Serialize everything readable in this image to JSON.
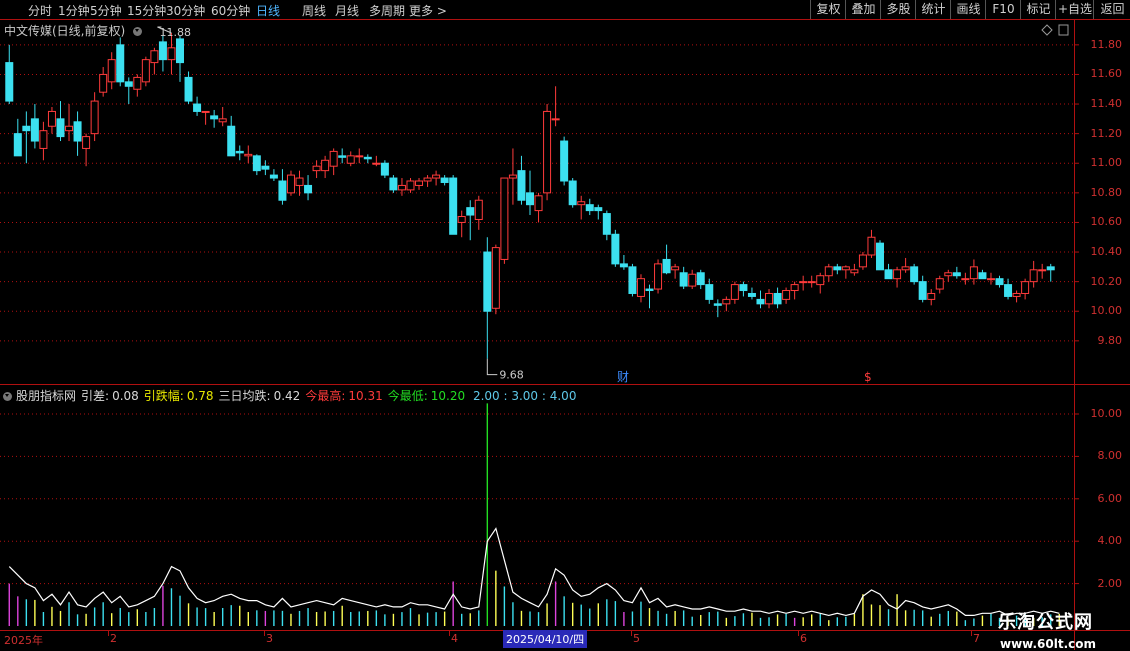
{
  "toolbar": {
    "periods": [
      "分时",
      "1分钟",
      "5分钟",
      "15分钟",
      "30分钟",
      "60分钟",
      "日线",
      "周线",
      "月线",
      "多周期",
      "更多 >"
    ],
    "active_period": "日线",
    "tools": [
      "复权",
      "叠加",
      "多股",
      "统计",
      "画线",
      "F10",
      "标记",
      "+自选",
      "返回"
    ]
  },
  "main_chart": {
    "title": "中文传媒(日线,前复权)",
    "high_label": "11.88",
    "low_label": "9.68",
    "markers": [
      "财",
      "$"
    ],
    "y_ticks": [
      "11.80",
      "11.60",
      "11.40",
      "11.20",
      "11.00",
      "10.80",
      "10.60",
      "10.40",
      "10.20",
      "10.00",
      "9.80"
    ]
  },
  "indicator": {
    "name": "股朋指标网",
    "items": [
      {
        "label": "引差:",
        "value": "0.08",
        "color": "#d8d8d8"
      },
      {
        "label": "引跌幅:",
        "value": "0.78",
        "color": "#e8e800"
      },
      {
        "label": "三日均跌:",
        "value": "0.42",
        "color": "#d8d8d8"
      },
      {
        "label": "今最高:",
        "value": "10.31",
        "color": "#ff3b3b"
      },
      {
        "label": "今最低:",
        "value": "10.20",
        "color": "#22dd22"
      }
    ],
    "extra_levels": "2.00 : 3.00 : 4.00",
    "y_ticks": [
      "10.00",
      "8.00",
      "6.00",
      "4.00",
      "2.00"
    ]
  },
  "x_axis": {
    "labels": [
      "2025年",
      "2",
      "3",
      "4",
      "5",
      "6",
      "7"
    ],
    "cursor_date": "2025/04/10/四"
  },
  "colors": {
    "up": "#ff3b3b",
    "down": "#3ce0f0",
    "grid": "#b01010",
    "line": "#ffffff"
  },
  "watermark": {
    "title": "乐淘公式网",
    "url": "www.60lt.com"
  },
  "chart_data": {
    "type": "candlestick",
    "candles": [
      [
        11.68,
        11.8,
        11.4,
        11.42
      ],
      [
        11.2,
        11.3,
        11.1,
        11.05
      ],
      [
        11.25,
        11.35,
        11.0,
        11.22
      ],
      [
        11.3,
        11.4,
        11.1,
        11.15
      ],
      [
        11.1,
        11.28,
        11.02,
        11.22
      ],
      [
        11.25,
        11.38,
        11.2,
        11.35
      ],
      [
        11.3,
        11.42,
        11.15,
        11.18
      ],
      [
        11.22,
        11.4,
        11.15,
        11.25
      ],
      [
        11.28,
        11.35,
        11.05,
        11.15
      ],
      [
        11.1,
        11.2,
        10.98,
        11.18
      ],
      [
        11.2,
        11.48,
        11.15,
        11.42
      ],
      [
        11.48,
        11.65,
        11.45,
        11.6
      ],
      [
        11.55,
        11.75,
        11.5,
        11.7
      ],
      [
        11.8,
        11.85,
        11.52,
        11.55
      ],
      [
        11.55,
        11.58,
        11.4,
        11.52
      ],
      [
        11.5,
        11.6,
        11.45,
        11.58
      ],
      [
        11.55,
        11.72,
        11.52,
        11.7
      ],
      [
        11.68,
        11.78,
        11.6,
        11.76
      ],
      [
        11.82,
        11.86,
        11.62,
        11.7
      ],
      [
        11.7,
        11.88,
        11.6,
        11.78
      ],
      [
        11.84,
        11.86,
        11.55,
        11.68
      ],
      [
        11.58,
        11.62,
        11.4,
        11.42
      ],
      [
        11.4,
        11.45,
        11.32,
        11.35
      ],
      [
        11.35,
        11.35,
        11.26,
        11.35
      ],
      [
        11.32,
        11.36,
        11.24,
        11.3
      ],
      [
        11.28,
        11.38,
        11.25,
        11.3
      ],
      [
        11.25,
        11.32,
        11.05,
        11.05
      ],
      [
        11.08,
        11.12,
        11.02,
        11.07
      ],
      [
        11.05,
        11.12,
        11.0,
        11.06
      ],
      [
        11.05,
        11.06,
        10.92,
        10.95
      ],
      [
        10.98,
        11.02,
        10.92,
        10.96
      ],
      [
        10.92,
        10.96,
        10.88,
        10.9
      ],
      [
        10.88,
        10.96,
        10.72,
        10.75
      ],
      [
        10.8,
        10.95,
        10.78,
        10.92
      ],
      [
        10.85,
        10.95,
        10.78,
        10.9
      ],
      [
        10.85,
        10.92,
        10.75,
        10.8
      ],
      [
        10.95,
        11.02,
        10.9,
        10.98
      ],
      [
        10.95,
        11.05,
        10.9,
        11.02
      ],
      [
        10.98,
        11.1,
        10.92,
        11.08
      ],
      [
        11.05,
        11.1,
        11.0,
        11.04
      ],
      [
        11.0,
        11.08,
        10.98,
        11.05
      ],
      [
        11.05,
        11.1,
        11.0,
        11.05
      ],
      [
        11.04,
        11.06,
        11.0,
        11.03
      ],
      [
        11.0,
        11.05,
        10.98,
        11.0
      ],
      [
        11.0,
        11.02,
        10.9,
        10.92
      ],
      [
        10.9,
        10.92,
        10.8,
        10.82
      ],
      [
        10.82,
        10.9,
        10.78,
        10.85
      ],
      [
        10.82,
        10.9,
        10.8,
        10.88
      ],
      [
        10.85,
        10.9,
        10.82,
        10.88
      ],
      [
        10.88,
        10.92,
        10.84,
        10.9
      ],
      [
        10.9,
        10.95,
        10.85,
        10.92
      ],
      [
        10.9,
        10.92,
        10.85,
        10.87
      ],
      [
        10.9,
        10.92,
        10.52,
        10.52
      ],
      [
        10.6,
        10.68,
        10.5,
        10.64
      ],
      [
        10.7,
        10.75,
        10.48,
        10.65
      ],
      [
        10.62,
        10.78,
        10.55,
        10.75
      ],
      [
        10.4,
        10.5,
        9.68,
        10.0
      ],
      [
        10.02,
        10.45,
        9.98,
        10.43
      ],
      [
        10.35,
        10.9,
        10.32,
        10.9
      ],
      [
        10.9,
        11.1,
        10.72,
        10.92
      ],
      [
        10.95,
        11.05,
        10.72,
        10.75
      ],
      [
        10.8,
        10.95,
        10.65,
        10.72
      ],
      [
        10.68,
        10.8,
        10.6,
        10.78
      ],
      [
        10.8,
        11.4,
        10.75,
        11.35
      ],
      [
        11.3,
        11.52,
        11.25,
        11.3
      ],
      [
        11.15,
        11.18,
        10.85,
        10.88
      ],
      [
        10.88,
        10.9,
        10.7,
        10.72
      ],
      [
        10.72,
        10.78,
        10.62,
        10.74
      ],
      [
        10.72,
        10.76,
        10.65,
        10.68
      ],
      [
        10.7,
        10.72,
        10.62,
        10.68
      ],
      [
        10.66,
        10.68,
        10.48,
        10.52
      ],
      [
        10.52,
        10.55,
        10.3,
        10.32
      ],
      [
        10.32,
        10.38,
        10.28,
        10.3
      ],
      [
        10.3,
        10.32,
        10.1,
        10.12
      ],
      [
        10.1,
        10.25,
        10.06,
        10.22
      ],
      [
        10.15,
        10.18,
        10.02,
        10.14
      ],
      [
        10.15,
        10.35,
        10.12,
        10.32
      ],
      [
        10.35,
        10.45,
        10.25,
        10.26
      ],
      [
        10.28,
        10.32,
        10.22,
        10.3
      ],
      [
        10.26,
        10.3,
        10.15,
        10.17
      ],
      [
        10.17,
        10.28,
        10.15,
        10.25
      ],
      [
        10.26,
        10.28,
        10.15,
        10.18
      ],
      [
        10.18,
        10.22,
        10.05,
        10.08
      ],
      [
        10.05,
        10.08,
        9.96,
        10.04
      ],
      [
        10.05,
        10.1,
        10.0,
        10.08
      ],
      [
        10.08,
        10.2,
        10.05,
        10.18
      ],
      [
        10.18,
        10.2,
        10.1,
        10.14
      ],
      [
        10.12,
        10.16,
        10.08,
        10.1
      ],
      [
        10.08,
        10.14,
        10.02,
        10.05
      ],
      [
        10.05,
        10.15,
        10.02,
        10.12
      ],
      [
        10.12,
        10.16,
        10.02,
        10.05
      ],
      [
        10.08,
        10.16,
        10.05,
        10.14
      ],
      [
        10.14,
        10.2,
        10.08,
        10.18
      ],
      [
        10.2,
        10.24,
        10.14,
        10.2
      ],
      [
        10.2,
        10.24,
        10.16,
        10.2
      ],
      [
        10.18,
        10.26,
        10.12,
        10.24
      ],
      [
        10.24,
        10.32,
        10.2,
        10.3
      ],
      [
        10.3,
        10.32,
        10.25,
        10.28
      ],
      [
        10.28,
        10.31,
        10.22,
        10.3
      ],
      [
        10.26,
        10.32,
        10.24,
        10.28
      ],
      [
        10.3,
        10.4,
        10.28,
        10.38
      ],
      [
        10.38,
        10.55,
        10.36,
        10.5
      ],
      [
        10.46,
        10.48,
        10.28,
        10.28
      ],
      [
        10.28,
        10.32,
        10.22,
        10.22
      ],
      [
        10.22,
        10.3,
        10.16,
        10.28
      ],
      [
        10.28,
        10.36,
        10.26,
        10.3
      ],
      [
        10.3,
        10.32,
        10.18,
        10.2
      ],
      [
        10.2,
        10.24,
        10.06,
        10.08
      ],
      [
        10.08,
        10.15,
        10.04,
        10.12
      ],
      [
        10.15,
        10.24,
        10.12,
        10.22
      ],
      [
        10.24,
        10.28,
        10.2,
        10.26
      ],
      [
        10.26,
        10.3,
        10.22,
        10.24
      ],
      [
        10.22,
        10.26,
        10.18,
        10.22
      ],
      [
        10.22,
        10.35,
        10.18,
        10.3
      ],
      [
        10.26,
        10.28,
        10.22,
        10.22
      ],
      [
        10.22,
        10.26,
        10.18,
        10.22
      ],
      [
        10.22,
        10.24,
        10.16,
        10.18
      ],
      [
        10.18,
        10.22,
        10.08,
        10.1
      ],
      [
        10.1,
        10.14,
        10.06,
        10.12
      ],
      [
        10.12,
        10.22,
        10.08,
        10.2
      ],
      [
        10.2,
        10.34,
        10.16,
        10.28
      ],
      [
        10.28,
        10.32,
        10.22,
        10.28
      ],
      [
        10.3,
        10.32,
        10.2,
        10.28
      ]
    ],
    "indicator_values": [
      2.8,
      2.4,
      2.0,
      1.8,
      1.2,
      1.5,
      1.0,
      1.6,
      1.0,
      0.9,
      1.3,
      1.6,
      1.1,
      1.4,
      0.9,
      1.0,
      1.2,
      1.4,
      2.0,
      2.8,
      2.6,
      1.8,
      1.3,
      1.1,
      1.2,
      1.4,
      1.5,
      1.3,
      1.2,
      1.2,
      1.0,
      0.9,
      1.3,
      0.9,
      1.0,
      1.1,
      1.2,
      1.1,
      1.0,
      1.3,
      1.2,
      1.1,
      1.0,
      0.9,
      1.0,
      0.9,
      0.9,
      1.1,
      1.0,
      1.0,
      0.9,
      0.8,
      1.5,
      0.9,
      0.8,
      0.9,
      4.0,
      4.6,
      3.1,
      1.6,
      1.3,
      1.1,
      0.9,
      1.5,
      2.7,
      2.4,
      1.7,
      1.4,
      1.5,
      1.8,
      2.0,
      1.7,
      1.2,
      1.1,
      1.8,
      1.1,
      1.3,
      0.9,
      1.0,
      0.9,
      0.8,
      0.8,
      0.9,
      0.8,
      0.7,
      0.7,
      0.8,
      0.7,
      0.7,
      0.6,
      0.7,
      0.6,
      0.7,
      0.6,
      0.7,
      0.6,
      0.5,
      0.6,
      0.5,
      0.6,
      1.4,
      1.7,
      1.5,
      1.0,
      0.8,
      1.2,
      1.1,
      0.9,
      0.8,
      0.9,
      1.0,
      0.8,
      0.5,
      0.5,
      0.6,
      0.6,
      0.7,
      0.5,
      0.6,
      0.6,
      0.7,
      0.6,
      0.7,
      0.6
    ]
  }
}
